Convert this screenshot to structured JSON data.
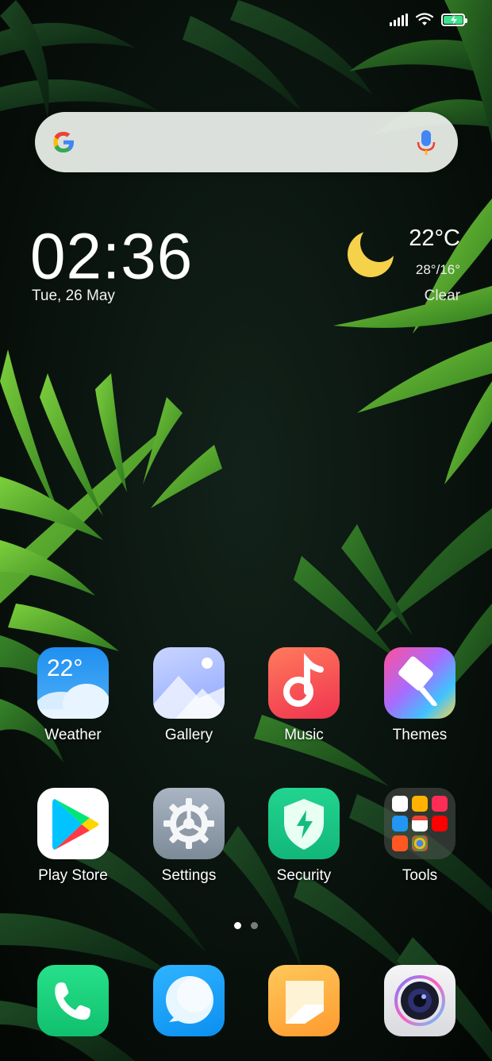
{
  "status_bar": {
    "icons": [
      "signal-icon",
      "wifi-icon",
      "battery-charging-icon"
    ],
    "battery_color": "#3fe08f"
  },
  "search": {
    "logo": "google-logo",
    "voice": "mic-icon"
  },
  "clock": {
    "time": "02:36",
    "date": "Tue, 26 May"
  },
  "weather_widget": {
    "icon": "moon-icon",
    "temperature": "22°C",
    "range": "28°/16°",
    "condition": "Clear"
  },
  "apps": [
    {
      "label": "Weather",
      "icon": "weather-icon",
      "icon_text": "22°"
    },
    {
      "label": "Gallery",
      "icon": "gallery-icon"
    },
    {
      "label": "Music",
      "icon": "music-icon"
    },
    {
      "label": "Themes",
      "icon": "themes-icon"
    },
    {
      "label": "Play Store",
      "icon": "play-store-icon"
    },
    {
      "label": "Settings",
      "icon": "settings-icon"
    },
    {
      "label": "Security",
      "icon": "security-icon"
    },
    {
      "label": "Tools",
      "icon": "folder-icon"
    }
  ],
  "page_indicator": {
    "current": 1,
    "total": 2
  },
  "dock": [
    {
      "icon": "phone-icon"
    },
    {
      "icon": "messages-icon"
    },
    {
      "icon": "notes-icon"
    },
    {
      "icon": "camera-icon"
    }
  ]
}
